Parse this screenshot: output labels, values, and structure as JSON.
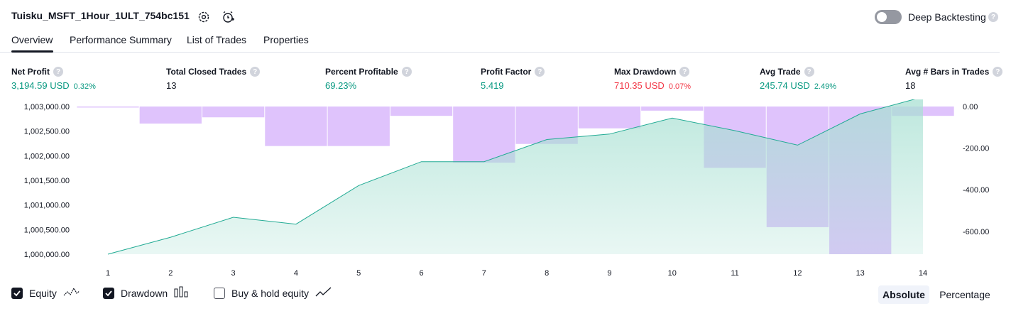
{
  "header": {
    "strategy_title": "Tuisku_MSFT_1Hour_1ULT_754bc151",
    "settings_icon": "gear-icon",
    "alert_icon": "alarm-clock-plus-icon",
    "deep_backtesting_label": "Deep Backtesting",
    "deep_backtesting_enabled": false,
    "help_glyph": "?"
  },
  "tabs": [
    {
      "label": "Overview",
      "active": true
    },
    {
      "label": "Performance Summary",
      "active": false
    },
    {
      "label": "List of Trades",
      "active": false
    },
    {
      "label": "Properties",
      "active": false
    }
  ],
  "metrics": [
    {
      "label": "Net Profit",
      "value": "3,194.59 USD",
      "pct": "0.32%",
      "color": "green"
    },
    {
      "label": "Total Closed Trades",
      "value": "13",
      "pct": "",
      "color": "dark"
    },
    {
      "label": "Percent Profitable",
      "value": "69.23%",
      "pct": "",
      "color": "green"
    },
    {
      "label": "Profit Factor",
      "value": "5.419",
      "pct": "",
      "color": "green"
    },
    {
      "label": "Max Drawdown",
      "value": "710.35 USD",
      "pct": "0.07%",
      "color": "red"
    },
    {
      "label": "Avg Trade",
      "value": "245.74 USD",
      "pct": "2.49%",
      "color": "green"
    },
    {
      "label": "Avg # Bars in Trades",
      "value": "18",
      "pct": "",
      "color": "dark"
    }
  ],
  "chart_data": {
    "type": "area",
    "x": [
      "1",
      "2",
      "3",
      "4",
      "5",
      "6",
      "7",
      "8",
      "9",
      "10",
      "11",
      "12",
      "13",
      "14"
    ],
    "left_axis": {
      "ticks": [
        "1,003,000.00",
        "1,002,500.00",
        "1,002,000.00",
        "1,001,500.00",
        "1,001,000.00",
        "1,000,500.00",
        "1,000,000.00"
      ],
      "ylim": [
        1000000,
        1003000
      ]
    },
    "right_axis": {
      "ticks": [
        "0.00",
        "-200.00",
        "-400.00",
        "-600.00"
      ],
      "ylim": [
        -710,
        0
      ]
    },
    "series": [
      {
        "name": "Equity",
        "axis": "left",
        "style": "line+area",
        "values": [
          1000000,
          1000345,
          1000750,
          1000610,
          1001395,
          1001880,
          1001880,
          1002330,
          1002440,
          1002765,
          1002510,
          1002215,
          1002850,
          1003195
        ]
      },
      {
        "name": "Drawdown",
        "axis": "right",
        "style": "bar",
        "values": [
          -5,
          -82,
          -52,
          -190,
          -190,
          -45,
          -270,
          -180,
          -105,
          -20,
          -295,
          -580,
          -710,
          -45
        ]
      }
    ],
    "colors": {
      "equity_line": "#22ab94",
      "equity_fill": "#b3e3d8",
      "drawdown_bar": "#d9b8fb"
    }
  },
  "legend_toggles": [
    {
      "label": "Equity",
      "checked": true,
      "icon": "equity-wave-icon"
    },
    {
      "label": "Drawdown",
      "checked": true,
      "icon": "drawdown-bars-icon"
    },
    {
      "label": "Buy & hold equity",
      "checked": false,
      "icon": "buy-hold-line-icon"
    }
  ],
  "scale_modes": [
    {
      "label": "Absolute",
      "active": true
    },
    {
      "label": "Percentage",
      "active": false
    }
  ]
}
